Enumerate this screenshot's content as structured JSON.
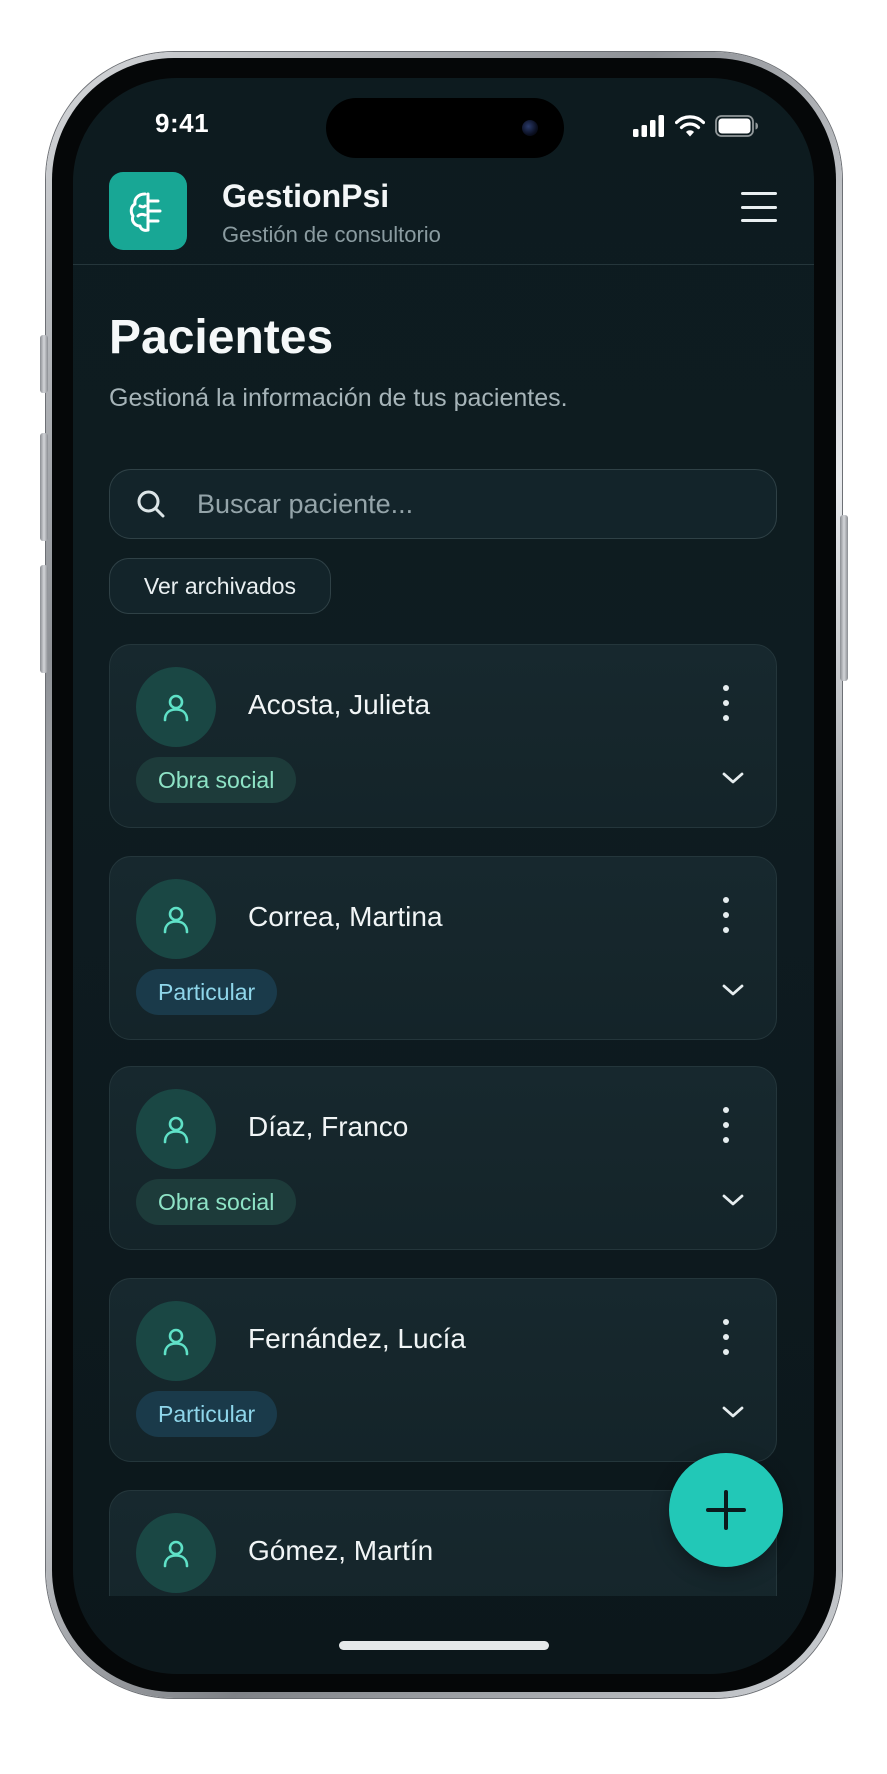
{
  "status_bar": {
    "time": "9:41"
  },
  "header": {
    "app_name": "GestionPsi",
    "subtitle": "Gestión de consultorio"
  },
  "page": {
    "title": "Pacientes",
    "subtitle": "Gestioná la información de tus pacientes."
  },
  "search": {
    "placeholder": "Buscar paciente..."
  },
  "archived_button": {
    "label": "Ver archivados"
  },
  "patients": [
    {
      "name": "Acosta, Julieta",
      "tag": "Obra social"
    },
    {
      "name": "Correa, Martina",
      "tag": "Particular"
    },
    {
      "name": "Díaz, Franco",
      "tag": "Obra social"
    },
    {
      "name": "Fernández, Lucía",
      "tag": "Particular"
    },
    {
      "name": "Gómez, Martín",
      "tag": ""
    }
  ],
  "colors": {
    "accent": "#22c8b7",
    "logo": "#18a795",
    "background": "#0e1c21",
    "tag_obra_social_text": "#8ee3c6",
    "tag_particular_text": "#8fd6ea"
  },
  "icons": {
    "logo": "brain-icon",
    "menu": "hamburger-menu-icon",
    "search": "search-icon",
    "avatar": "user-icon",
    "more": "more-vertical-icon",
    "expand": "chevron-down-icon",
    "add": "plus-icon"
  }
}
